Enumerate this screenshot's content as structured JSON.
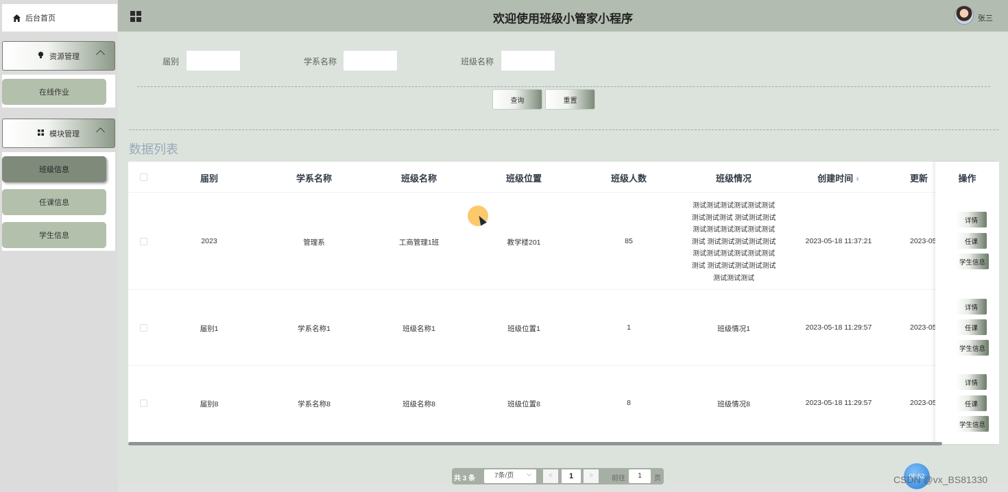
{
  "sidebar": {
    "home_label": "后台首页",
    "groups": [
      {
        "label": "资源管理",
        "items": [
          "在线作业"
        ]
      },
      {
        "label": "模块管理",
        "items": [
          "班级信息",
          "任课信息",
          "学生信息"
        ]
      }
    ]
  },
  "header": {
    "title": "欢迎使用班级小管家小程序",
    "username": "张三"
  },
  "search": {
    "fields": [
      {
        "label": "届别",
        "value": ""
      },
      {
        "label": "学系名称",
        "value": ""
      },
      {
        "label": "班级名称",
        "value": ""
      }
    ],
    "query_label": "查询",
    "reset_label": "重置"
  },
  "list": {
    "title": "数据列表",
    "columns": [
      "届别",
      "学系名称",
      "班级名称",
      "班级位置",
      "班级人数",
      "班级情况",
      "创建时间",
      "更新",
      "操作"
    ],
    "rows": [
      {
        "jiebie": "2023",
        "xuexi": "管理系",
        "banji": "工商管理1班",
        "weizhi": "教学楼201",
        "renshu": "85",
        "qingkuang": [
          "测试测试测试测试测试测试",
          "测试测试测试 测试测试测试",
          "测试测试测试测试测试测试",
          "测试 测试测试测试测试测试",
          "测试测试测试测试测试测试",
          "测试 测试测试测试测试测试",
          "测试测试测试"
        ],
        "created": "2023-05-18 11:37:21",
        "updated": "2023-05"
      },
      {
        "jiebie": "届别1",
        "xuexi": "学系名称1",
        "banji": "班级名称1",
        "weizhi": "班级位置1",
        "renshu": "1",
        "qingkuang": [
          "班级情况1"
        ],
        "created": "2023-05-18 11:29:57",
        "updated": "2023-05"
      },
      {
        "jiebie": "届别8",
        "xuexi": "学系名称8",
        "banji": "班级名称8",
        "weizhi": "班级位置8",
        "renshu": "8",
        "qingkuang": [
          "班级情况8"
        ],
        "created": "2023-05-18 11:29:57",
        "updated": "2023-05"
      }
    ],
    "actions": [
      "详情",
      "任课",
      "学生信息"
    ]
  },
  "pagination": {
    "total": "共 3 条",
    "page_size": "7条/页",
    "prev": "<",
    "current": "1",
    "next": ">",
    "goto_label": "前往",
    "goto_value": "1",
    "goto_unit": "页"
  },
  "overlay": {
    "time": "05:52",
    "watermark": "CSDN @vx_BS81330"
  }
}
